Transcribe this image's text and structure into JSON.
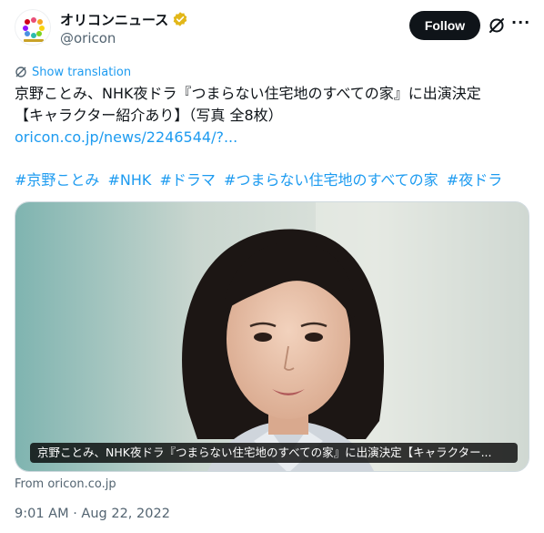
{
  "account": {
    "display_name": "オリコンニュース",
    "handle": "@oricon",
    "verified_color": "#e2b719"
  },
  "actions": {
    "follow_label": "Follow",
    "more_label": "···"
  },
  "translation": {
    "label": "Show translation"
  },
  "tweet": {
    "line1": "京野ことみ、NHK夜ドラ『つまらない住宅地のすべての家』に出演決定",
    "line2": "【キャラクター紹介あり】（写真 全8枚）",
    "link": "oricon.co.jp/news/2246544/?...",
    "hashtags": [
      "#京野ことみ",
      "#NHK",
      "#ドラマ",
      "#つまらない住宅地のすべての家",
      "#夜ドラ"
    ]
  },
  "media": {
    "caption": "京野ことみ、NHK夜ドラ『つまらない住宅地のすべての家』に出演決定【キャラクター..."
  },
  "source": "From oricon.co.jp",
  "timestamp": "9:01 AM · Aug 22, 2022",
  "colors": {
    "accent": "#1d9bf0",
    "text": "#0f1419",
    "muted": "#536471"
  }
}
